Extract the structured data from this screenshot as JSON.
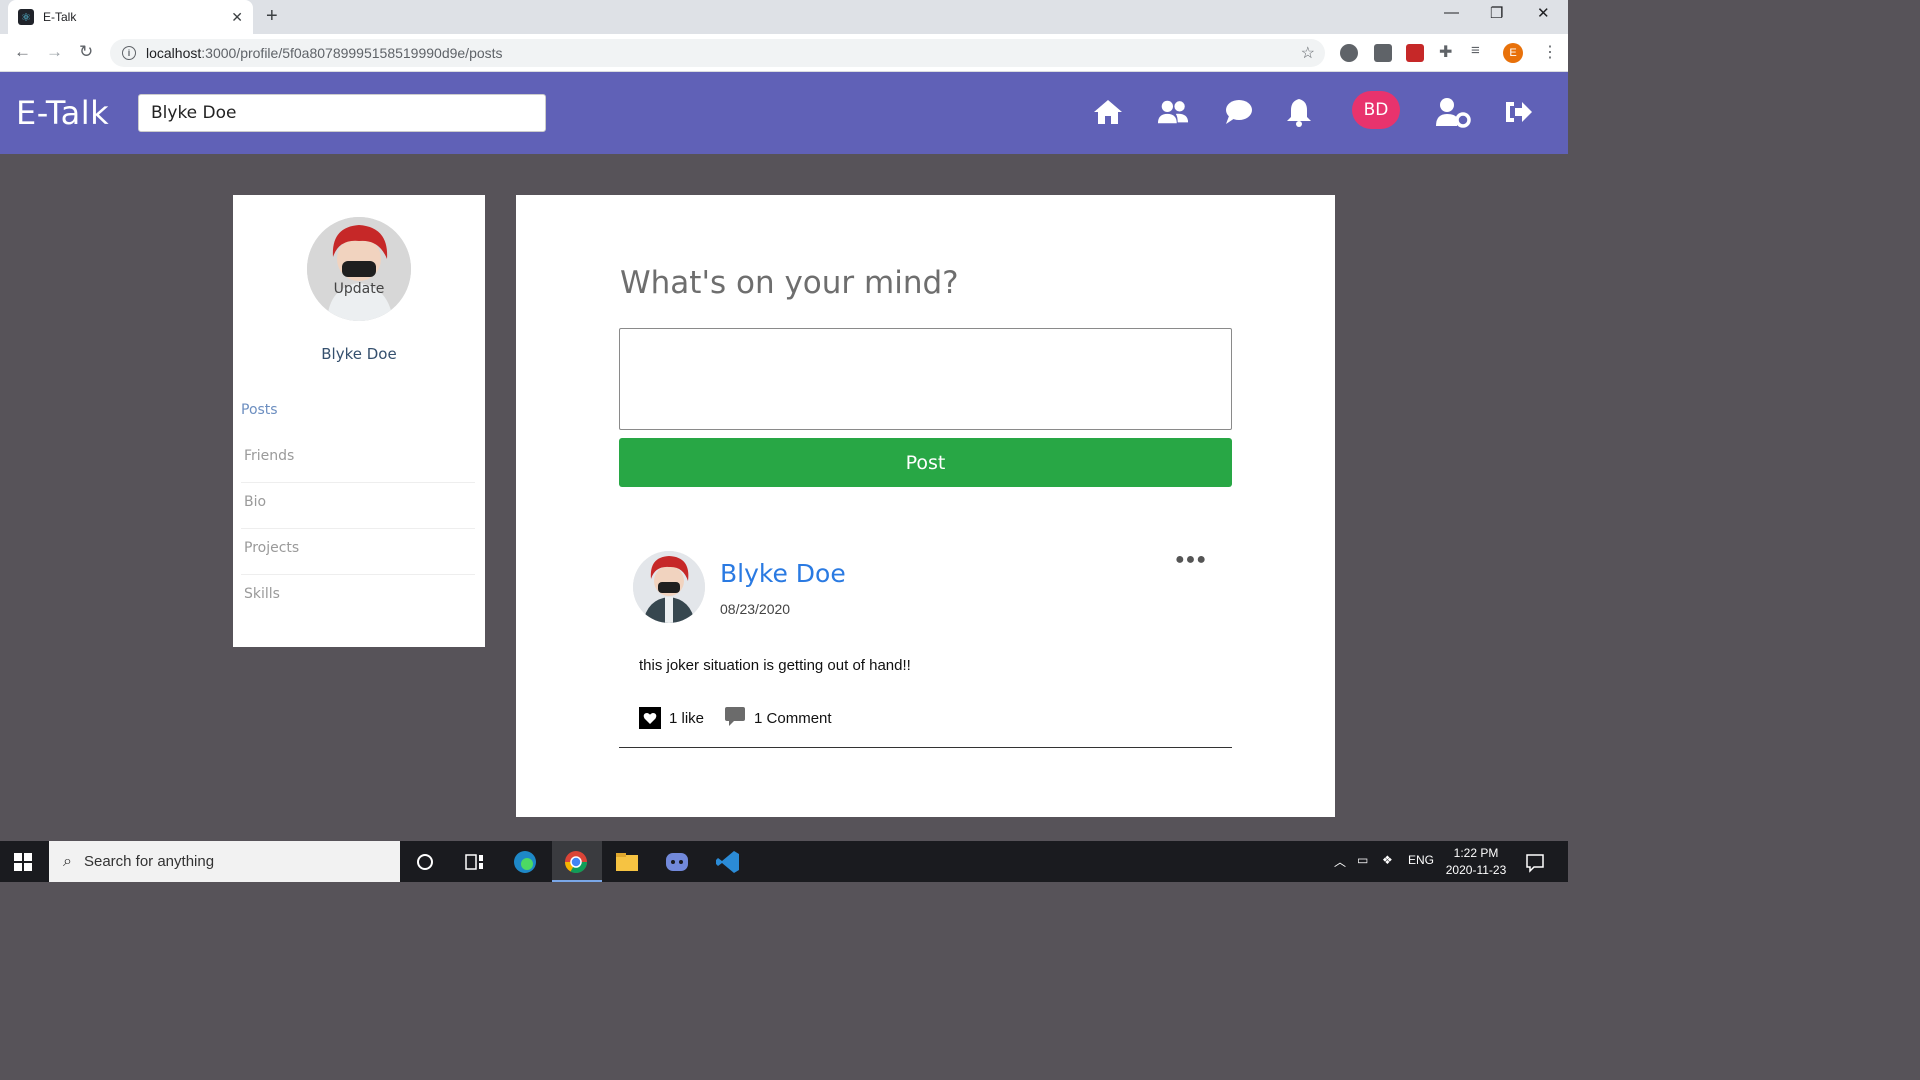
{
  "browser": {
    "tab_title": "E-Talk",
    "url_host": "localhost",
    "url_rest": ":3000/profile/5f0a80789995158519990d9e/posts",
    "profile_initial": "E"
  },
  "header": {
    "brand": "E-Talk",
    "search_value": "Blyke Doe",
    "user_initials": "BD",
    "icons": [
      "home-icon",
      "friends-icon",
      "chat-icon",
      "bell-icon",
      "user-settings-icon",
      "logout-icon"
    ],
    "accent_color": "#6061b7"
  },
  "sidebar": {
    "update_label": "Update",
    "name": "Blyke Doe",
    "items": [
      {
        "label": "Posts"
      },
      {
        "label": "Friends"
      },
      {
        "label": "Bio"
      },
      {
        "label": "Projects"
      },
      {
        "label": "Skills"
      }
    ]
  },
  "composer": {
    "title": "What's on your mind?",
    "input_value": "",
    "post_label": "Post",
    "post_color": "#28a745"
  },
  "post": {
    "author": "Blyke Doe",
    "date": "08/23/2020",
    "text": "this joker situation is getting out of hand!!",
    "likes_label": "1 like",
    "comments_label": "1 Comment"
  },
  "taskbar": {
    "search_placeholder": "Search for anything",
    "language": "ENG",
    "time": "1:22 PM",
    "date": "2020-11-23"
  }
}
